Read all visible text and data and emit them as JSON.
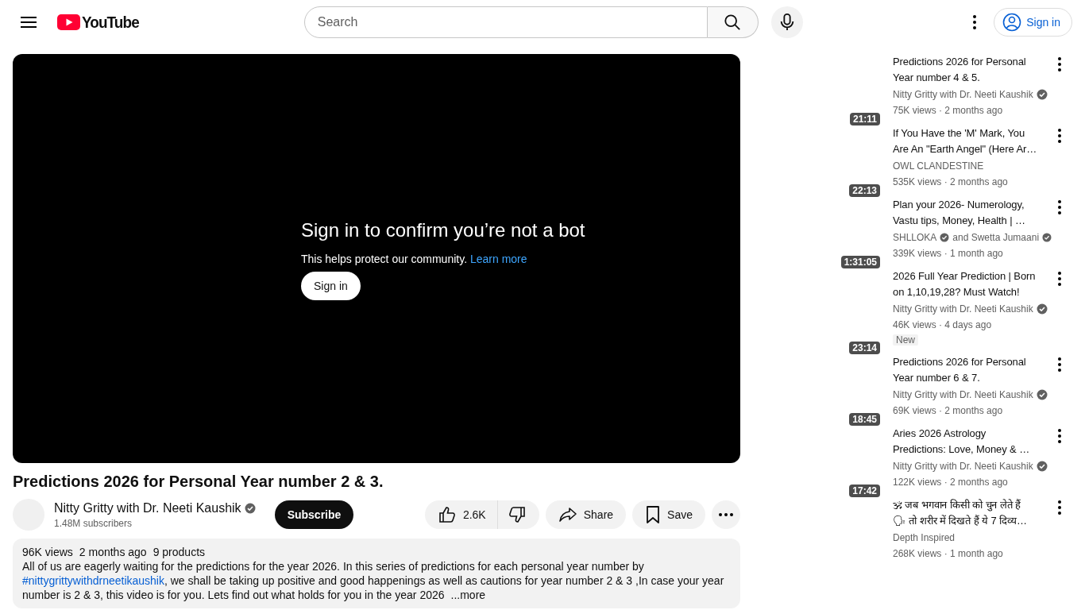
{
  "header": {
    "logo": "YouTube",
    "search_placeholder": "Search",
    "sign_in": "Sign in"
  },
  "player": {
    "heading": "Sign in to confirm you’re not a bot",
    "message": "This helps protect our community.",
    "link": "Learn more",
    "button": "Sign in"
  },
  "video": {
    "title": "Predictions 2026 for Personal Year number 2 & 3.",
    "channel": "Nitty Gritty with Dr. Neeti Kaushik",
    "verified": true,
    "subscribers": "1.48M subscribers",
    "subscribe": "Subscribe",
    "likes": "2.6K",
    "share": "Share",
    "save": "Save"
  },
  "description": {
    "stats": [
      "96K views",
      "2 months ago",
      "9 products"
    ],
    "text_before": "All of us are eagerly waiting for the predictions for the year 2026. In this series of predictions for each personal year number by ",
    "hashtag": "#nittygrittywithdrneetikaushik",
    "text_after": ", we shall be taking up positive and good happenings as well as cautions for  year number 2 & 3 ,In case your year number is 2 & 3, this video is for you. Lets find out what holds for you in the year 2026",
    "more": "...more"
  },
  "recommendations": [
    {
      "title_lines": [
        "Predictions 2026 for Personal",
        "Year number 4 & 5."
      ],
      "channels": [
        {
          "name": "Nitty Gritty with Dr. Neeti Kaushik",
          "verified": true
        }
      ],
      "meta": "75K views · 2 months ago",
      "duration": "21:11"
    },
    {
      "title_lines": [
        "If You Have the 'M' Mark, You",
        "Are An \"Earth Angel\" (Here Ar…"
      ],
      "channels": [
        {
          "name": "OWL CLANDESTINE",
          "verified": false
        }
      ],
      "meta": "535K views · 2 months ago",
      "duration": "22:13"
    },
    {
      "title_lines": [
        "Plan your 2026- Numerology,",
        "Vastu tips, Money, Health | …"
      ],
      "channels": [
        {
          "name": "SHLLOKA",
          "verified": true
        },
        {
          "name": "and Swetta Jumaani",
          "verified": true
        }
      ],
      "meta": "339K views · 1 month ago",
      "duration": "1:31:05"
    },
    {
      "title_lines": [
        "2026 Full Year Prediction | Born",
        "on 1,10,19,28? Must Watch!"
      ],
      "channels": [
        {
          "name": "Nitty Gritty with Dr. Neeti Kaushik",
          "verified": true
        }
      ],
      "meta": "46K views · 4 days ago",
      "duration": "23:14",
      "badge": "New"
    },
    {
      "title_lines": [
        "Predictions 2026 for Personal",
        "Year number 6 & 7."
      ],
      "channels": [
        {
          "name": "Nitty Gritty with Dr. Neeti Kaushik",
          "verified": true
        }
      ],
      "meta": "69K views · 2 months ago",
      "duration": "18:45"
    },
    {
      "title_lines": [
        "Aries 2026 Astrology",
        "Predictions: Love, Money & …"
      ],
      "channels": [
        {
          "name": "Nitty Gritty with Dr. Neeti Kaushik",
          "verified": true
        }
      ],
      "meta": "122K views · 2 months ago",
      "duration": "17:42"
    },
    {
      "title_lines": [
        "🕉 जब भगवान किसी को चुन लेते हैं",
        "🗣 तो शरीर में दिखते हैं ये 7 दिव्य…"
      ],
      "channels": [
        {
          "name": "Depth Inspired",
          "verified": false
        }
      ],
      "meta": "268K views · 1 month ago"
    }
  ]
}
